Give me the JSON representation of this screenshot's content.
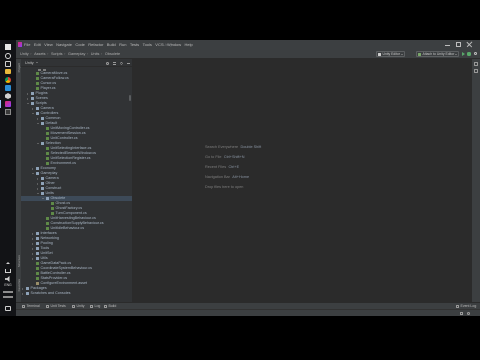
{
  "colors": {
    "editor_bg": "#2b2b2b",
    "panel_bg": "#313335",
    "chrome_bg": "#3c3f41",
    "taskbar_bg": "#121316",
    "tree_text": "#a9b7c6",
    "selection_bg": "#3d4a58",
    "hint_text": "#7f7f7f"
  },
  "taskbar": {
    "language": "ENG"
  },
  "window": {
    "title": "Unity"
  },
  "menu": {
    "items": [
      "File",
      "Edit",
      "View",
      "Navigate",
      "Code",
      "Refactor",
      "Build",
      "Run",
      "Tests",
      "Tools",
      "VCS",
      "Window",
      "Help"
    ]
  },
  "navbar": {
    "breadcrumb": [
      "Unity",
      "Assets",
      "Scripts",
      "Gameplay",
      "Units",
      "Obsolete"
    ],
    "unity_config": "Unity Editor",
    "run_config": "Attach to Unity Editor"
  },
  "project": {
    "header": "Unity",
    "tree": [
      {
        "label": "CameraMove.cs",
        "depth": 2,
        "kind": "file"
      },
      {
        "label": "CameraFollow.cs",
        "depth": 2,
        "kind": "file"
      },
      {
        "label": "Cursor.cs",
        "depth": 2,
        "kind": "file"
      },
      {
        "label": "Player.cs",
        "depth": 2,
        "kind": "file"
      },
      {
        "label": "Plugins",
        "depth": 1,
        "kind": "folder",
        "expanded": false
      },
      {
        "label": "Scenes",
        "depth": 1,
        "kind": "folder",
        "expanded": false
      },
      {
        "label": "Scripts",
        "depth": 1,
        "kind": "folder",
        "expanded": true
      },
      {
        "label": "Camera",
        "depth": 2,
        "kind": "folder",
        "expanded": false
      },
      {
        "label": "Controllers",
        "depth": 2,
        "kind": "folder",
        "expanded": true
      },
      {
        "label": "Common",
        "depth": 3,
        "kind": "folder",
        "expanded": false
      },
      {
        "label": "Default",
        "depth": 3,
        "kind": "folder",
        "expanded": true
      },
      {
        "label": "UnitMovingController.cs",
        "depth": 4,
        "kind": "file"
      },
      {
        "label": "MovementSession.cs",
        "depth": 4,
        "kind": "file"
      },
      {
        "label": "UnitController.cs",
        "depth": 4,
        "kind": "file"
      },
      {
        "label": "Selection",
        "depth": 3,
        "kind": "folder",
        "expanded": true
      },
      {
        "label": "UnitSelectingInterface.cs",
        "depth": 4,
        "kind": "file"
      },
      {
        "label": "SelectedElementWindow.cs",
        "depth": 4,
        "kind": "file"
      },
      {
        "label": "UnitSelectionRegister.cs",
        "depth": 4,
        "kind": "file"
      },
      {
        "label": "Environment.cs",
        "depth": 4,
        "kind": "file"
      },
      {
        "label": "Economy",
        "depth": 2,
        "kind": "folder",
        "expanded": false
      },
      {
        "label": "Gameplay",
        "depth": 2,
        "kind": "folder",
        "expanded": true
      },
      {
        "label": "Camera",
        "depth": 3,
        "kind": "folder",
        "expanded": false
      },
      {
        "label": "Other",
        "depth": 3,
        "kind": "folder",
        "expanded": false
      },
      {
        "label": "Construct",
        "depth": 3,
        "kind": "folder",
        "expanded": false
      },
      {
        "label": "Units",
        "depth": 3,
        "kind": "folder",
        "expanded": true
      },
      {
        "label": "Obsolete",
        "depth": 4,
        "kind": "folder",
        "expanded": true,
        "selected": true
      },
      {
        "label": "Ghost.cs",
        "depth": 5,
        "kind": "file"
      },
      {
        "label": "GhostFactory.cs",
        "depth": 5,
        "kind": "file"
      },
      {
        "label": "TurnComponent.cs",
        "depth": 5,
        "kind": "file"
      },
      {
        "label": "UnitHarvestingBehaviour.cs",
        "depth": 4,
        "kind": "file"
      },
      {
        "label": "ConstructionSupplyBehaviour.cs",
        "depth": 4,
        "kind": "file"
      },
      {
        "label": "UnitIdleBehaviour.cs",
        "depth": 4,
        "kind": "file"
      },
      {
        "label": "Interfaces",
        "depth": 2,
        "kind": "folder",
        "expanded": false
      },
      {
        "label": "Networking",
        "depth": 2,
        "kind": "folder",
        "expanded": false
      },
      {
        "label": "Pooling",
        "depth": 2,
        "kind": "folder",
        "expanded": false
      },
      {
        "label": "Tools",
        "depth": 2,
        "kind": "folder",
        "expanded": false
      },
      {
        "label": "UnitSet",
        "depth": 2,
        "kind": "folder",
        "expanded": false
      },
      {
        "label": "Utils",
        "depth": 2,
        "kind": "folder",
        "expanded": false
      },
      {
        "label": "GameDataPack.cs",
        "depth": 2,
        "kind": "file"
      },
      {
        "label": "CoordinateSystemBehaviour.cs",
        "depth": 2,
        "kind": "file"
      },
      {
        "label": "BattleController.cs",
        "depth": 2,
        "kind": "file"
      },
      {
        "label": "StatsProvider.cs",
        "depth": 2,
        "kind": "file"
      },
      {
        "label": "ConfigureEnvironment.asset",
        "depth": 2,
        "kind": "file"
      },
      {
        "label": "Packages",
        "depth": 0,
        "kind": "folder",
        "expanded": false
      },
      {
        "label": "Scratches and Consoles",
        "depth": 0,
        "kind": "folder",
        "expanded": false
      }
    ]
  },
  "editor": {
    "hints": [
      {
        "label": "Search Everywhere",
        "shortcut": "Double Shift"
      },
      {
        "label": "Go to File",
        "shortcut": "Ctrl+Shift+N"
      },
      {
        "label": "Recent Files",
        "shortcut": "Ctrl+E"
      },
      {
        "label": "Navigation Bar",
        "shortcut": "Alt+Home"
      }
    ],
    "drop_text": "Drop files here to open"
  },
  "tool_windows": {
    "left": [
      "Project",
      "Structure",
      "Favorites"
    ],
    "bottom": [
      "Terminal",
      "Unit Tests",
      "Unity",
      "Log",
      "Build"
    ],
    "event_log": "Event Log"
  }
}
